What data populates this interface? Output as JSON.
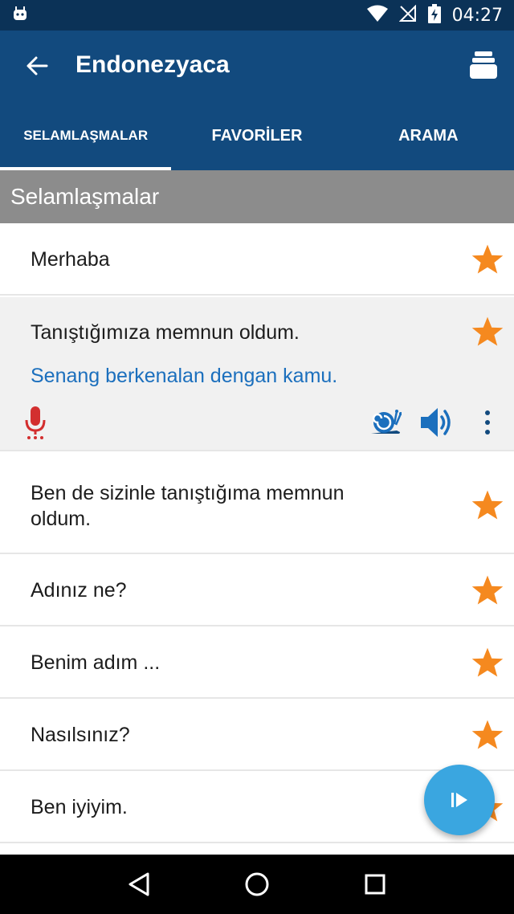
{
  "status_bar": {
    "time": "04:27"
  },
  "app_bar": {
    "title": "Endonezyaca"
  },
  "tabs": [
    {
      "label": "SELAMLAŞMALAR",
      "active": true
    },
    {
      "label": "FAVORİLER",
      "active": false
    },
    {
      "label": "ARAMA",
      "active": false
    }
  ],
  "section": {
    "title": "Selamlaşmalar"
  },
  "phrases": [
    {
      "text": "Merhaba"
    },
    {
      "text": "Tanıştığımıza memnun oldum.",
      "translation": "Senang berkenalan dengan kamu."
    },
    {
      "text": "Ben de sizinle tanıştığıma memnun oldum."
    },
    {
      "text": "Adınız ne?"
    },
    {
      "text": "Benim adım ..."
    },
    {
      "text": "Nasılsınız?"
    },
    {
      "text": "Ben iyiyim."
    }
  ],
  "colors": {
    "app_bar": "#124a7e",
    "status_bar": "#0b3257",
    "star": "#f5891f",
    "translation": "#1b6fbd",
    "mic": "#d32f2f",
    "fab": "#3aa6e0"
  },
  "icons": {
    "back": "arrow-left-icon",
    "menu": "stack-icon",
    "star": "star-icon",
    "mic": "microphone-icon",
    "slow": "snail-icon",
    "play": "speaker-icon",
    "more": "more-vertical-icon",
    "fab": "play-icon"
  }
}
